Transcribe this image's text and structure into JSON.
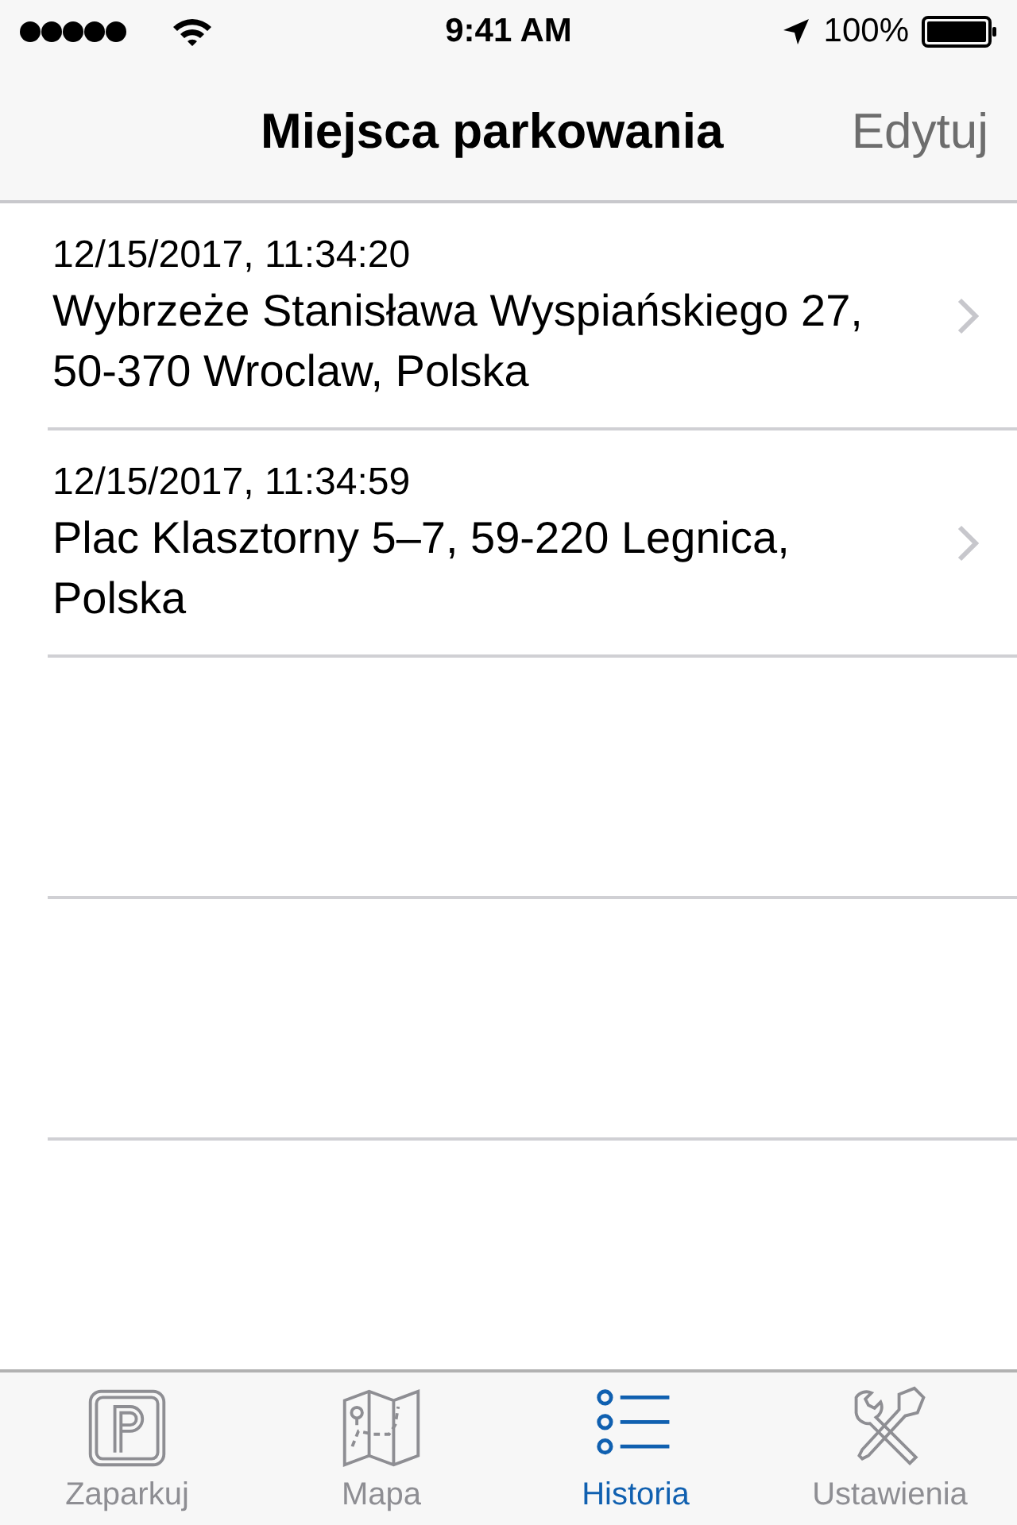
{
  "status_bar": {
    "time": "9:41 AM",
    "battery": "100%"
  },
  "nav": {
    "title": "Miejsca parkowania",
    "edit": "Edytuj"
  },
  "rows": [
    {
      "date": "12/15/2017, 11:34:20",
      "address": "Wybrzeże Stanisława Wyspiańskiego 27, 50-370 Wroclaw, Polska"
    },
    {
      "date": "12/15/2017, 11:34:59",
      "address": "Plac Klasztorny 5–7, 59-220 Legnica, Polska"
    }
  ],
  "tabs": [
    {
      "label": "Zaparkuj",
      "selected": false
    },
    {
      "label": "Mapa",
      "selected": false
    },
    {
      "label": "Historia",
      "selected": true
    },
    {
      "label": "Ustawienia",
      "selected": false
    }
  ]
}
